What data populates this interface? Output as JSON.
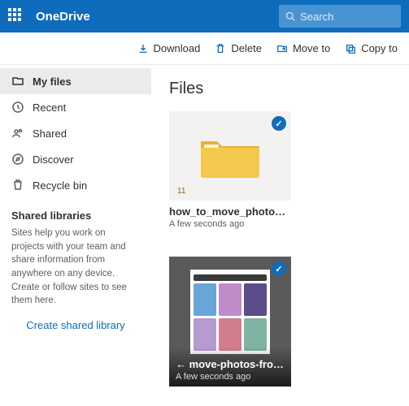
{
  "brand": "OneDrive",
  "search": {
    "placeholder": "Search"
  },
  "commands": {
    "download": "Download",
    "delete": "Delete",
    "moveto": "Move to",
    "copyto": "Copy to"
  },
  "sidebar": {
    "items": [
      {
        "label": "My files"
      },
      {
        "label": "Recent"
      },
      {
        "label": "Shared"
      },
      {
        "label": "Discover"
      },
      {
        "label": "Recycle bin"
      }
    ],
    "libHeader": "Shared libraries",
    "libText": "Sites help you work on projects with your team and share information from anywhere on any device. Create or follow sites to see them here.",
    "libLink": "Create shared library"
  },
  "main": {
    "title": "Files",
    "items": [
      {
        "name": "how_to_move_photos_f…",
        "meta": "A few seconds ago",
        "count": "11"
      },
      {
        "name": "move-photos-from-go…",
        "meta": "A few seconds ago"
      }
    ]
  }
}
